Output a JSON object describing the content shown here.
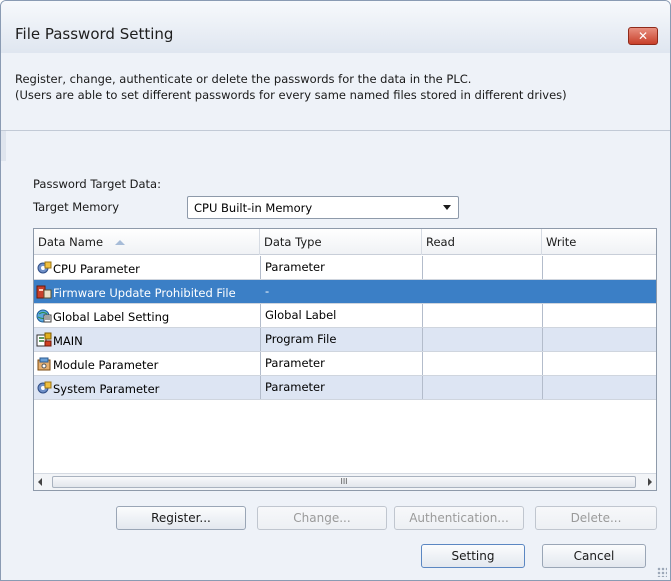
{
  "window": {
    "title": "File Password Setting",
    "close_label": "✕"
  },
  "description": {
    "line1": "Register, change, authenticate or delete the passwords for the data in the PLC.",
    "line2": "(Users are able to set different passwords for every same named files stored in different drives)"
  },
  "target": {
    "data_label": "Password Target Data:",
    "memory_label": "Target Memory",
    "memory_value": "CPU Built-in Memory"
  },
  "table": {
    "columns": {
      "name": "Data Name",
      "type": "Data Type",
      "read": "Read",
      "write": "Write"
    },
    "rows": [
      {
        "name": "CPU Parameter",
        "type": "Parameter",
        "read": "",
        "write": "",
        "icon": "cpu-parameter-icon"
      },
      {
        "name": "Firmware Update Prohibited File",
        "type": "-",
        "read": "",
        "write": "",
        "icon": "firmware-file-icon"
      },
      {
        "name": "Global Label Setting",
        "type": "Global Label",
        "read": "",
        "write": "",
        "icon": "global-label-icon"
      },
      {
        "name": "MAIN",
        "type": "Program File",
        "read": "",
        "write": "",
        "icon": "program-file-icon"
      },
      {
        "name": "Module Parameter",
        "type": "Parameter",
        "read": "",
        "write": "",
        "icon": "module-parameter-icon"
      },
      {
        "name": "System Parameter",
        "type": "Parameter",
        "read": "",
        "write": "",
        "icon": "system-parameter-icon"
      }
    ],
    "scroll_thumb_label": "III"
  },
  "buttons": {
    "register": "Register...",
    "change": "Change...",
    "authentication": "Authentication...",
    "delete": "Delete...",
    "setting": "Setting",
    "cancel": "Cancel"
  },
  "colors": {
    "selection": "#3b7fc6",
    "alt_row": "#dde5f3"
  }
}
